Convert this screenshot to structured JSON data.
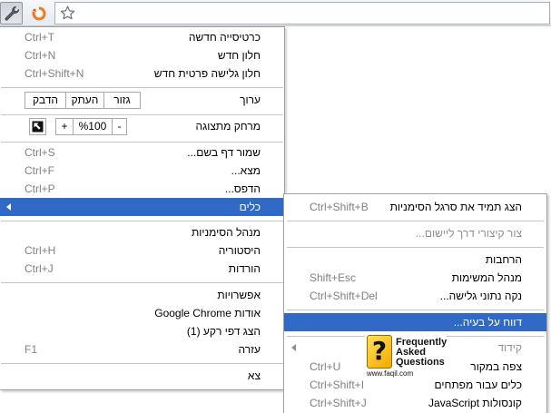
{
  "colors": {
    "highlight": "#3169c6",
    "highlight_text": "#ffffff",
    "text": "#000000",
    "shortcut": "#808080",
    "disabled": "#8e8e8e",
    "separator": "#c4c4c4"
  },
  "toolbar": {
    "menu_button_icon": "wrench-icon",
    "extension_icon": "refresh-icon",
    "bookmark_star_icon": "star-icon"
  },
  "main_menu": {
    "new_tab": {
      "label": "כרטיסייה חדשה",
      "shortcut": "Ctrl+T"
    },
    "new_window": {
      "label": "חלון חדש",
      "shortcut": "Ctrl+N"
    },
    "new_incognito": {
      "label": "חלון גלישה פרטית חדש",
      "shortcut": "Ctrl+Shift+N"
    },
    "edit": {
      "label": "ערוך",
      "cut": "גזור",
      "copy": "העתק",
      "paste": "הדבק"
    },
    "zoom": {
      "label": "מרחק מתצוגה",
      "plus": "+",
      "value": "%100",
      "minus": "-",
      "fullscreen_icon": "fullscreen-icon"
    },
    "save_page": {
      "label": "שמור דף בשם...",
      "shortcut": "Ctrl+S"
    },
    "find": {
      "label": "מצא...",
      "shortcut": "Ctrl+F"
    },
    "print": {
      "label": "הדפס...",
      "shortcut": "Ctrl+P"
    },
    "tools": {
      "label": "כלים",
      "arrow_icon": "chevron-left-icon"
    },
    "bookmark_manager": {
      "label": "מנהל הסימניות"
    },
    "history": {
      "label": "היסטוריה",
      "shortcut": "Ctrl+H"
    },
    "downloads": {
      "label": "הורדות",
      "shortcut": "Ctrl+J"
    },
    "options": {
      "label": "אפשרויות"
    },
    "about": {
      "label": "אודות Google Chrome"
    },
    "background_pages": {
      "label": "הצג דפי רקע (1)"
    },
    "help": {
      "label": "עזרה",
      "shortcut": "F1"
    },
    "exit": {
      "label": "צא"
    }
  },
  "tools_submenu": {
    "always_show_bookmarks_bar": {
      "label": "הצג תמיד את סרגל הסימניות",
      "shortcut": "Ctrl+Shift+B"
    },
    "create_app_shortcuts": {
      "label": "צור קיצורי דרך ליישום...",
      "disabled": true
    },
    "extensions": {
      "label": "הרחבות"
    },
    "task_manager": {
      "label": "מנהל המשימות",
      "shortcut": "Shift+Esc"
    },
    "clear_browsing_data": {
      "label": "נקה נתוני גלישה...",
      "shortcut": "Ctrl+Shift+Del"
    },
    "report_issue": {
      "label": "דווח על בעיה..."
    },
    "encoding": {
      "label": "קידוד",
      "arrow_icon": "chevron-left-icon"
    },
    "view_source": {
      "label": "צפה במקור",
      "shortcut": "Ctrl+U"
    },
    "developer_tools": {
      "label": "כלים עבור מפתחים",
      "shortcut": "Ctrl+Shift+I"
    },
    "javascript_console": {
      "label": "קונסולות JavaScript",
      "shortcut": "Ctrl+Shift+J"
    }
  },
  "watermark": {
    "glyph": "?",
    "line1": "Frequently",
    "line2": "Asked",
    "line3": "Questions",
    "url": "www.faqil.com",
    "icon": "question-mark-icon"
  }
}
